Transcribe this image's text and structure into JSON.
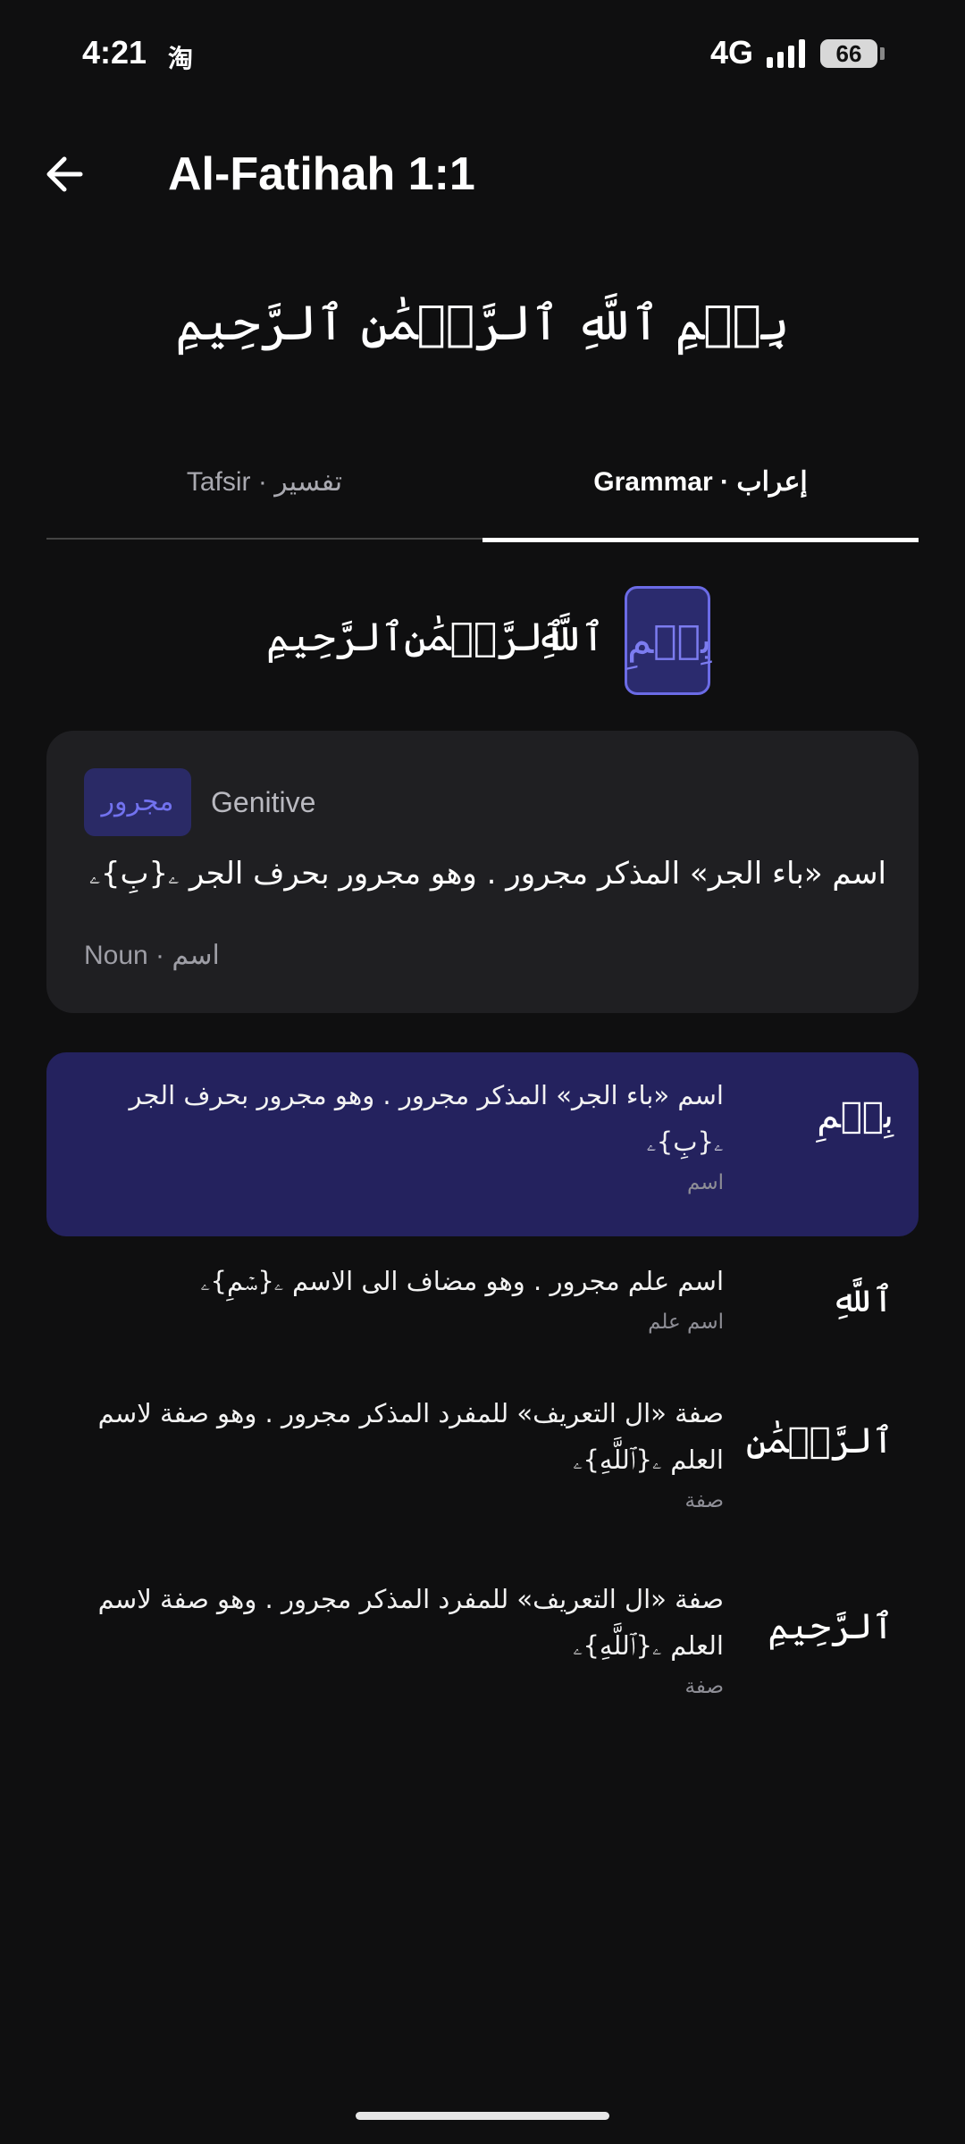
{
  "status": {
    "time": "4:21",
    "app_icon": "淘",
    "network": "4G",
    "battery": "66"
  },
  "header": {
    "title": "Al-Fatihah 1:1"
  },
  "verse": {
    "arabic": "بِسۡمِ ٱللَّهِ ٱلرَّحۡمَٰنِ ٱلرَّحِيمِ"
  },
  "tabs": [
    {
      "label": "Tafsir · تفسير"
    },
    {
      "label": "Grammar · إعراب"
    }
  ],
  "words": [
    "بِسۡمِ",
    "ٱللَّهِ",
    "ٱلرَّحۡمَٰنِ",
    "ٱلرَّحِيمِ"
  ],
  "detail": {
    "case_badge": "مجرور",
    "case_label": "Genitive",
    "description": "اسم «باء الجر» المذكر مجرور . وهو مجرور بحرف الجر ۦ{بِ}ۦ",
    "pos": "Noun · اسم"
  },
  "analysis": [
    {
      "word": "بِسۡمِ",
      "text": "اسم «باء الجر» المذكر مجرور . وهو مجرور بحرف الجر ۦ{بِ}ۦ",
      "sub": "اسم"
    },
    {
      "word": "ٱللَّهِ",
      "text": "اسم علم مجرور . وهو مضاف الى الاسم ۦ{سۡمِ}ۦ",
      "sub": "اسم علم"
    },
    {
      "word": "ٱلرَّحۡمَٰنِ",
      "text": "صفة «ال التعريف» للمفرد المذكر مجرور . وهو صفة لاسم العلم ۦ{ٱللَّهِ}ۦ",
      "sub": "صفة"
    },
    {
      "word": "ٱلرَّحِيمِ",
      "text": "صفة «ال التعريف» للمفرد المذكر مجرور . وهو صفة لاسم العلم ۦ{ٱللَّهِ}ۦ",
      "sub": "صفة"
    }
  ],
  "colors": {
    "accent": "#6b6be6",
    "highlight": "#24225e",
    "card": "#1f1f22",
    "background": "#0f0f10"
  }
}
